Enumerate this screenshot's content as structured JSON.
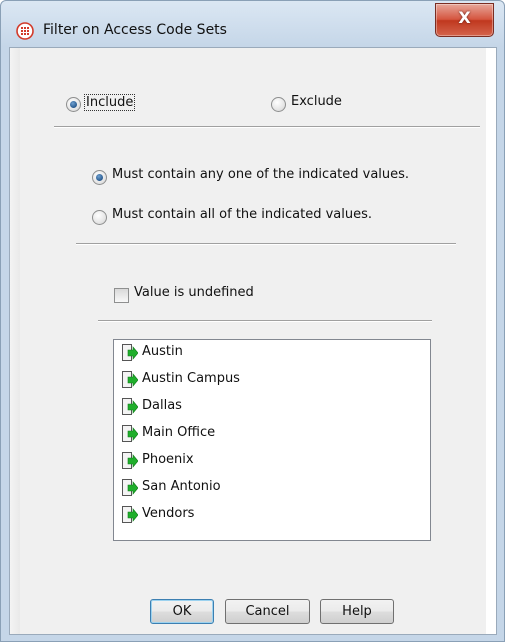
{
  "window": {
    "title": "Filter on Access Code Sets",
    "close_label": "X",
    "title_icon": "access-code-icon"
  },
  "mode": {
    "include_label": "Include",
    "exclude_label": "Exclude",
    "selected": "include"
  },
  "match": {
    "any_label": "Must contain any one of the indicated values.",
    "all_label": "Must contain all of the indicated values.",
    "selected": "any"
  },
  "undefined_checkbox": {
    "label": "Value is undefined",
    "checked": false
  },
  "values": [
    {
      "label": "Austin",
      "icon": "access-code-arrow-icon"
    },
    {
      "label": "Austin Campus",
      "icon": "access-code-arrow-icon"
    },
    {
      "label": "Dallas",
      "icon": "access-code-arrow-icon"
    },
    {
      "label": "Main Office",
      "icon": "access-code-arrow-icon"
    },
    {
      "label": "Phoenix",
      "icon": "access-code-arrow-icon"
    },
    {
      "label": "San Antonio",
      "icon": "access-code-arrow-icon"
    },
    {
      "label": "Vendors",
      "icon": "access-code-arrow-icon"
    }
  ],
  "buttons": {
    "ok": "OK",
    "cancel": "Cancel",
    "help": "Help"
  },
  "colors": {
    "accent_green": "#1fae2b",
    "title_icon_red": "#d23a2a",
    "close_red": "#c0381f"
  }
}
